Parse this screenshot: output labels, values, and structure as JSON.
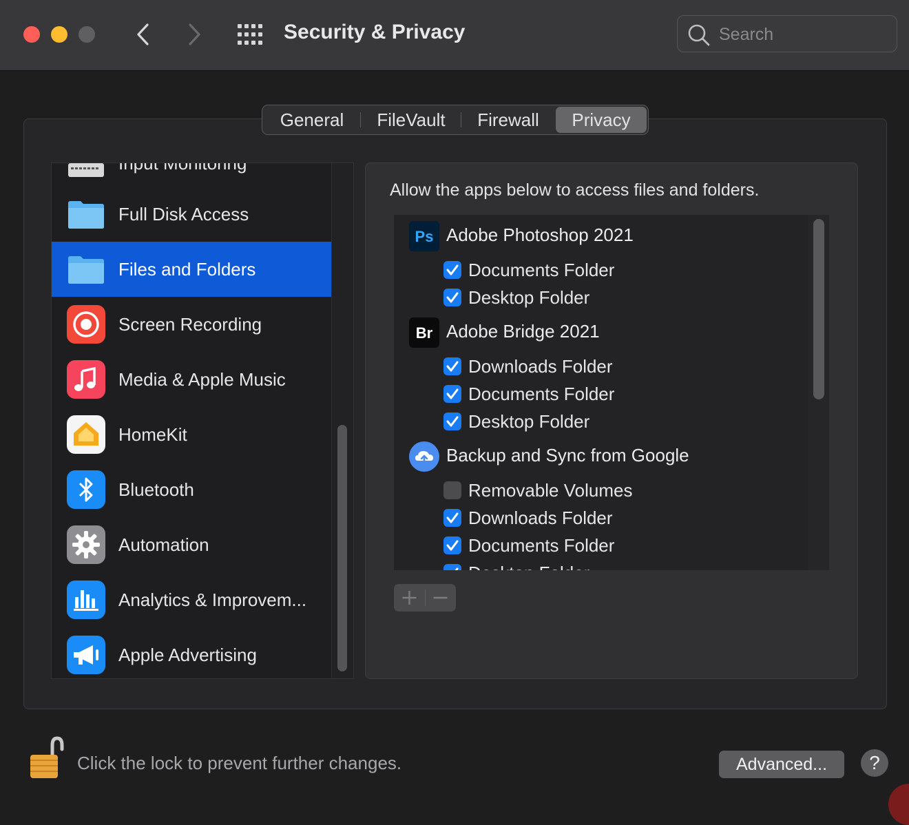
{
  "window": {
    "title": "Security & Privacy",
    "search_placeholder": "Search"
  },
  "tabs": [
    {
      "label": "General"
    },
    {
      "label": "FileVault"
    },
    {
      "label": "Firewall"
    },
    {
      "label": "Privacy",
      "selected": true
    }
  ],
  "sidebar": {
    "partial_item": "Input Monitoring",
    "items": [
      {
        "label": "Full Disk Access",
        "icon": "folder-icon"
      },
      {
        "label": "Files and Folders",
        "icon": "folder-icon",
        "selected": true
      },
      {
        "label": "Screen Recording",
        "icon": "screen-recording-icon"
      },
      {
        "label": "Media & Apple Music",
        "icon": "music-note-icon"
      },
      {
        "label": "HomeKit",
        "icon": "home-icon"
      },
      {
        "label": "Bluetooth",
        "icon": "bluetooth-icon"
      },
      {
        "label": "Automation",
        "icon": "gear-icon"
      },
      {
        "label": "Analytics & Improvem...",
        "icon": "analytics-icon"
      },
      {
        "label": "Apple Advertising",
        "icon": "megaphone-icon"
      }
    ]
  },
  "main": {
    "description": "Allow the apps below to access files and folders.",
    "apps": [
      {
        "name": "Adobe Photoshop 2021",
        "icon_text": "Ps",
        "permissions": [
          {
            "label": "Documents Folder",
            "checked": true
          },
          {
            "label": "Desktop Folder",
            "checked": true
          }
        ]
      },
      {
        "name": "Adobe Bridge 2021",
        "icon_text": "Br",
        "permissions": [
          {
            "label": "Downloads Folder",
            "checked": true
          },
          {
            "label": "Documents Folder",
            "checked": true
          },
          {
            "label": "Desktop Folder",
            "checked": true
          }
        ]
      },
      {
        "name": "Backup and Sync from Google",
        "icon": "cloud-upload-icon",
        "permissions": [
          {
            "label": "Removable Volumes",
            "checked": false
          },
          {
            "label": "Downloads Folder",
            "checked": true
          },
          {
            "label": "Documents Folder",
            "checked": true
          },
          {
            "label": "Desktop Folder",
            "checked": true
          }
        ]
      }
    ],
    "add_label": "+",
    "remove_label": "−"
  },
  "footer": {
    "lock_text": "Click the lock to prevent further changes.",
    "advanced_label": "Advanced...",
    "help_label": "?"
  },
  "colors": {
    "accent": "#0f5ad6",
    "checkbox": "#1a7cf5"
  }
}
